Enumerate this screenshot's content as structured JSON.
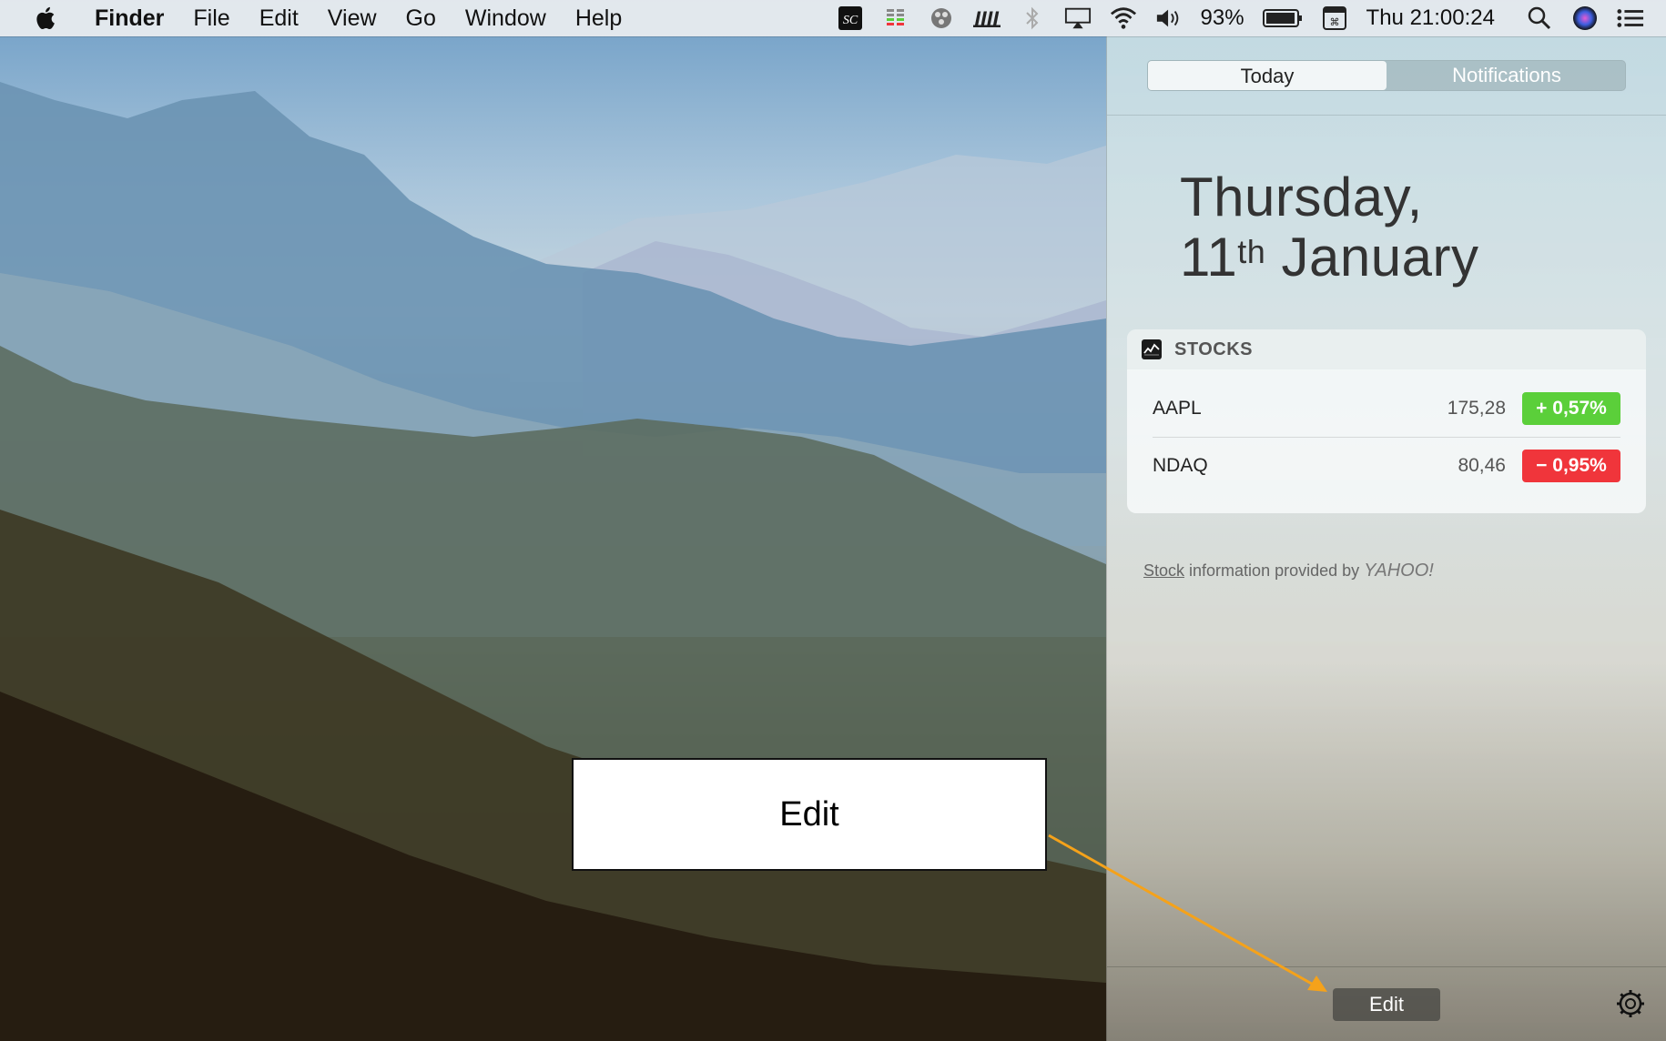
{
  "menubar": {
    "app_name": "Finder",
    "menus": [
      "File",
      "Edit",
      "View",
      "Go",
      "Window",
      "Help"
    ],
    "battery": "93%",
    "clock": "Thu 21:00:24",
    "icons": [
      "sc-app-icon",
      "activity-meter-icon",
      "kit-icon",
      "bookshelf-icon",
      "bluetooth-icon",
      "airplay-icon",
      "wifi-icon",
      "volume-icon",
      "battery-icon",
      "keyboard-icon",
      "search-icon",
      "siri-icon",
      "notification-list-icon"
    ]
  },
  "notification_center": {
    "tabs": [
      {
        "label": "Today",
        "active": true
      },
      {
        "label": "Notifications",
        "active": false
      }
    ],
    "date_line1": "Thursday,",
    "date_day": "11",
    "date_suffix": "th",
    "date_month": "January",
    "stocks_widget": {
      "title": "STOCKS",
      "rows": [
        {
          "symbol": "AAPL",
          "price": "175,28",
          "change": "+ 0,57%",
          "direction": "up"
        },
        {
          "symbol": "NDAQ",
          "price": "80,46",
          "change": "− 0,95%",
          "direction": "down"
        }
      ]
    },
    "credit_link": "Stock",
    "credit_text": " information provided by ",
    "credit_brand": "YAHOO!",
    "edit_label": "Edit"
  },
  "annotation": {
    "label": "Edit",
    "arrow_color": "#f5a21a"
  },
  "colors": {
    "up": "#5bcf3a",
    "down": "#f0353b"
  }
}
